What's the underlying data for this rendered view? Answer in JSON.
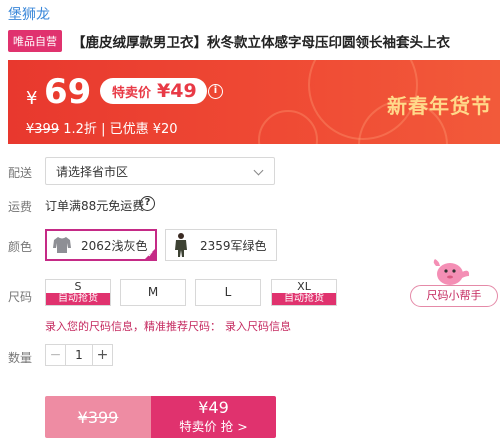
{
  "brand": "堡狮龙",
  "product": {
    "badge": "唯品自营",
    "title": "【鹿皮绒厚款男卫衣】秋冬款立体感字母压印圆领长袖套头上衣"
  },
  "price": {
    "currency": "¥",
    "main": "69",
    "special_label": "特卖价",
    "special_value": "¥49",
    "original": "¥399",
    "discount": "1.2折",
    "saved": "| 已优惠 ¥20",
    "festival": "新春年货节"
  },
  "shipping_to": {
    "label": "配送",
    "placeholder": "请选择省市区"
  },
  "freight": {
    "label": "运费",
    "text": "订单满88元免运费"
  },
  "color": {
    "label": "颜色",
    "options": [
      {
        "name": "2062浅灰色",
        "selected": true,
        "swatch": "#8e8f95"
      },
      {
        "name": "2359军绿色",
        "selected": false,
        "swatch": "#3d4233"
      }
    ]
  },
  "size": {
    "label": "尺码",
    "options": [
      {
        "name": "S",
        "tag": "自动抢货"
      },
      {
        "name": "M",
        "tag": ""
      },
      {
        "name": "L",
        "tag": ""
      },
      {
        "name": "XL",
        "tag": "自动抢货"
      }
    ],
    "helper": "尺码小帮手",
    "tip": "录入您的尺码信息，精准推荐尺码：",
    "tip_link": "录入尺码信息"
  },
  "quantity": {
    "label": "数量",
    "value": "1"
  },
  "buy": {
    "original": "¥399",
    "price": "¥49",
    "label": "特卖价 抢 >"
  }
}
